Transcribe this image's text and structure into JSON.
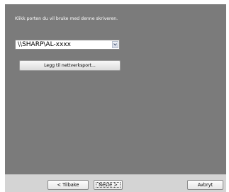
{
  "dialog": {
    "instruction": "Klikk porten du vil bruke med denne skriveren.",
    "port_select": {
      "value": "\\\\SHARP\\AL-xxxx"
    },
    "add_port_label": "Legg til nettverksport..."
  },
  "footer": {
    "back_label": "< Tilbake",
    "next_label": "Neste >",
    "cancel_label": "Avbryt"
  },
  "colors": {
    "content_bg": "#7b7b7b",
    "footer_bg": "#d4d4d4"
  },
  "icons": {
    "dropdown": "chevron-down-icon"
  }
}
